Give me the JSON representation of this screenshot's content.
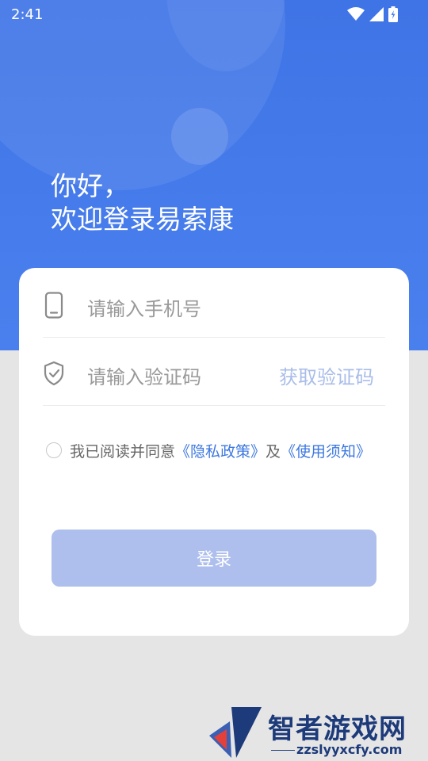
{
  "status_bar": {
    "time": "2:41",
    "icons": [
      "wifi-icon",
      "cellular-signal-icon",
      "battery-charging-icon"
    ]
  },
  "greeting": {
    "line1": "你好，",
    "line2": "欢迎登录易索康"
  },
  "login_form": {
    "phone_placeholder": "请输入手机号",
    "code_placeholder": "请输入验证码",
    "get_code_label": "获取验证码",
    "agreement": {
      "prefix": "我已阅读并同意",
      "privacy_link": "《隐私政策》",
      "connector": "及",
      "terms_link": "《使用须知》"
    },
    "login_button": "登录"
  },
  "watermark": {
    "title": "智者游戏网",
    "url": "zzslyyxcfy.com"
  },
  "colors": {
    "header_blue": "#4178E8",
    "link_blue": "#3D78E0",
    "button_disabled": "#AEBFED",
    "get_code_text": "#A9BDE9",
    "background": "#E5E5E5"
  }
}
